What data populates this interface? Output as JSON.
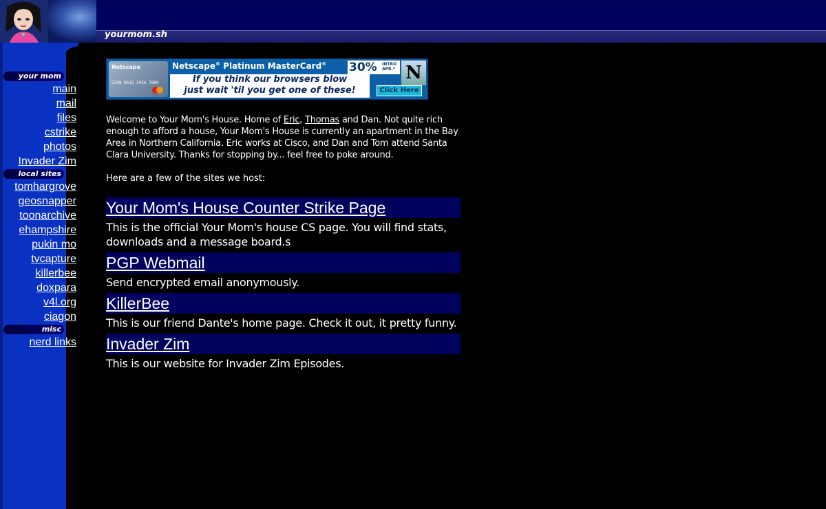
{
  "header": {
    "site_name": "yourmom.sh"
  },
  "sidebar": {
    "groups": [
      {
        "title": "your mom",
        "links": [
          "main",
          "mail",
          "files",
          "cstrike",
          "photos",
          "Invader Zim"
        ]
      },
      {
        "title": "local sites",
        "links": [
          "tomhargrove",
          "geosnapper",
          "toonarchive",
          "ehampshire",
          "pukin mo",
          "tvcapture",
          "killerbee",
          "doxpara",
          "v4l.org",
          "ciagon"
        ]
      },
      {
        "title": "misc",
        "links": [
          "nerd links"
        ]
      }
    ]
  },
  "banner": {
    "card_logo": "Netscape",
    "card_number": "5398 0b12 3456 7890",
    "card_name": "L. WILLIAMS",
    "headline": "Netscape",
    "headline_rest": " Platinum MasterCard",
    "rate": "30%",
    "rate_note_1": "INTRO",
    "rate_note_2": "APR.*",
    "tagline_1": "If you think our browsers blow",
    "tagline_2": "just wait 'til you get one of these!",
    "logo_letter": "N",
    "click": "Click Here",
    "colors": {
      "background": "#0d5fa8",
      "click_button": "#18b8d8"
    }
  },
  "main": {
    "intro_1": "Welcome to Your Mom's House. Home of ",
    "intro_link_eric": "Eric",
    "intro_sep": ", ",
    "intro_link_thomas": "Thomas",
    "intro_2": " and Dan. Not quite rich enough to afford a house, Your Mom's House is currently an apartment in the Bay Area in Northern California. Eric works at Cisco, and Dan and Tom attend Santa Clara University. Thanks for stopping by... feel free to poke around.",
    "sites_intro": "Here are a few of the sites we host:",
    "sites": [
      {
        "title": "Your Mom's House Counter Strike Page",
        "desc": "This is the official Your Mom's house CS page. You will find stats, downloads and a message board.s"
      },
      {
        "title": "PGP Webmail",
        "desc": "Send encrypted email anonymously."
      },
      {
        "title": "KillerBee",
        "desc": "This is our friend Dante's home page. Check it out, it pretty funny."
      },
      {
        "title": "Invader Zim",
        "desc": "This is our website for Invader Zim Episodes."
      }
    ]
  },
  "colors": {
    "header_bg": "#01015e",
    "sidebar_bg": "#0a32c2",
    "page_bg": "#000000",
    "text": "#ffffff"
  }
}
